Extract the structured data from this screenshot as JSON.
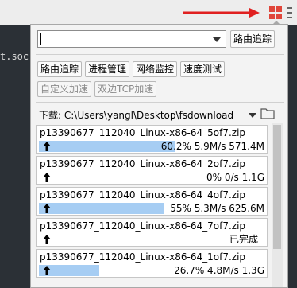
{
  "page": {
    "background_text": "t.soc"
  },
  "colors": {
    "arrow": "#e02020",
    "ext_icon": "#e0463a",
    "progress_fill": "#a6cdf3"
  },
  "popup": {
    "host_input": {
      "value": "",
      "placeholder": ""
    },
    "trace_button": "路由追踪",
    "tools": [
      "路由追踪",
      "进程管理",
      "网络监控",
      "速度测试"
    ],
    "accel": [
      "自定义加速",
      "双边TCP加速"
    ],
    "download": {
      "label": "下载: C:\\Users\\yangl\\Desktop\\fsdownload"
    },
    "items": [
      {
        "name": "p13390677_112040_Linux-x86-64_5of7.zip",
        "status": "60.2% 5.9M/s 571.4M",
        "progress": 0.602
      },
      {
        "name": "p13390677_112040_Linux-x86-64_2of7.zip",
        "status": "0% 0/s 1.1G",
        "progress": 0
      },
      {
        "name": "p13390677_112040_Linux-x86-64_4of7.zip",
        "status": "55% 5.3M/s 625.6M",
        "progress": 0.55
      },
      {
        "name": "p13390677_112040_Linux-x86-64_7of7.zip",
        "status": "已完成",
        "progress": 0
      },
      {
        "name": "p13390677_112040_Linux-x86-64_1of7.zip",
        "status": "26.7% 4.8M/s 1.3G",
        "progress": 0.267
      }
    ]
  }
}
